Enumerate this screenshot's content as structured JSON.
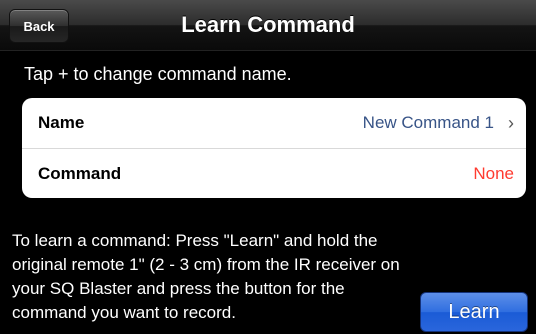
{
  "navbar": {
    "back_label": "Back",
    "title": "Learn Command"
  },
  "hint": "Tap + to change command name.",
  "table": {
    "rows": [
      {
        "label": "Name",
        "value": "New Command 1",
        "chevron": "›"
      },
      {
        "label": "Command",
        "value": "None"
      }
    ]
  },
  "instructions": "To learn a command: Press \"Learn\" and hold the original remote 1\" (2 - 3 cm) from the IR receiver on your SQ Blaster and press the button for the command you want to record.",
  "learn_button": "Learn",
  "colors": {
    "value_blue": "#385487",
    "none_red": "#ff3b30",
    "button_blue": "#2f6ee0"
  }
}
